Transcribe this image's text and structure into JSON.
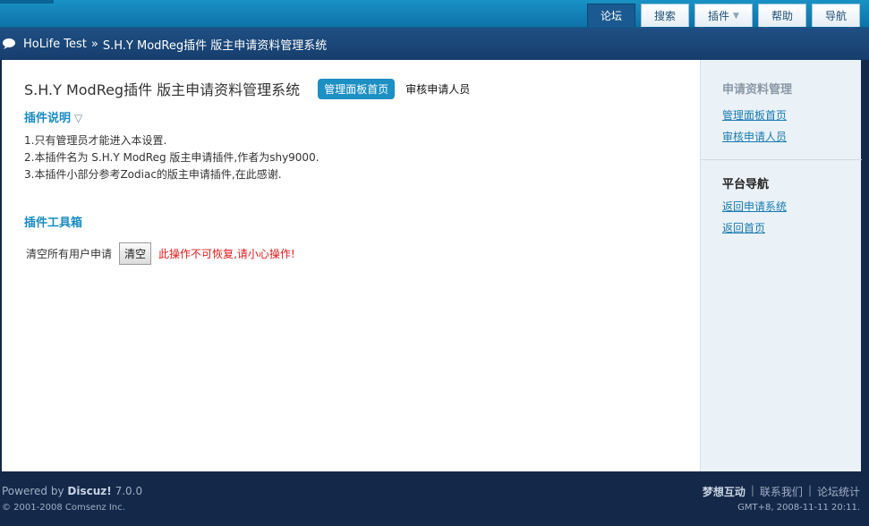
{
  "nav": {
    "items": [
      {
        "label": "论坛",
        "active": true
      },
      {
        "label": "搜索",
        "active": false
      },
      {
        "label": "插件",
        "active": false,
        "dropdown": true
      },
      {
        "label": "帮助",
        "active": false
      },
      {
        "label": "导航",
        "active": false
      }
    ]
  },
  "breadcrumb": {
    "site": "HoLife Test",
    "separator": "»",
    "current": "S.H.Y ModReg插件 版主申请资料管理系统"
  },
  "main": {
    "title": "S.H.Y ModReg插件 版主申请资料管理系统",
    "home_button": "管理面板首页",
    "review_link": "审核申请人员",
    "intro_heading": "插件说明",
    "intro_lines": [
      "1.只有管理员才能进入本设置.",
      "2.本插件名为 S.H.Y ModReg 版主申请插件,作者为shy9000.",
      "3.本插件小部分参考Zodiac的版主申请插件,在此感谢."
    ],
    "toolbox_heading": "插件工具箱",
    "clear_label": "清空所有用户申请",
    "clear_button": "清空",
    "warning": "此操作不可恢复,请小心操作!"
  },
  "sidebar": {
    "section1_title": "申请资料管理",
    "section1_links": [
      "管理面板首页",
      "审核申请人员"
    ],
    "section2_title": "平台导航",
    "section2_links": [
      "返回申请系统",
      "返回首页"
    ]
  },
  "footer": {
    "powered_prefix": "Powered by",
    "powered_brand": "Discuz!",
    "version": "7.0.0",
    "copyright": "© 2001-2008 Comsenz Inc.",
    "links": [
      "梦想互动",
      "联系我们",
      "论坛统计"
    ],
    "gmt": "GMT+8, 2008-11-11 20:11."
  },
  "colors": {
    "accent": "#1a8cc0",
    "warning": "#e01b1b",
    "nav_active": "#1b5a90"
  }
}
